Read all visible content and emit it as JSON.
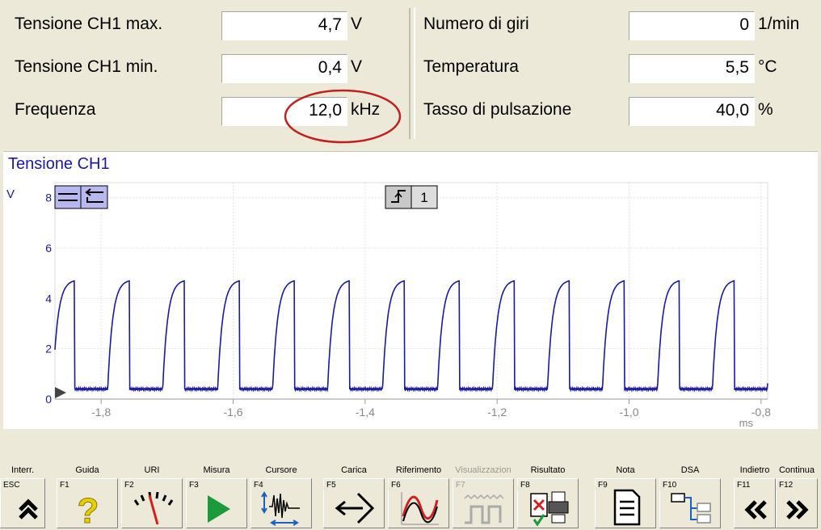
{
  "measurements_left": [
    {
      "label": "Tensione CH1 max.",
      "value": "4,7",
      "unit": "V"
    },
    {
      "label": "Tensione CH1 min.",
      "value": "0,4",
      "unit": "V"
    },
    {
      "label": "Frequenza",
      "value": "12,0",
      "unit": "kHz"
    }
  ],
  "measurements_right": [
    {
      "label": "Numero di giri",
      "value": "0",
      "unit": "1/min"
    },
    {
      "label": "Temperatura",
      "value": "5,5",
      "unit": "°C"
    },
    {
      "label": "Tasso di pulsazione",
      "value": "40,0",
      "unit": "%"
    }
  ],
  "highlight_color": "#c0201f",
  "chart": {
    "title": "Tensione CH1",
    "ylabel": "V",
    "xunit": "ms",
    "trigger_channel": "1",
    "y_ticks": [
      "8",
      "6",
      "4",
      "2",
      "0"
    ],
    "x_ticks": [
      "-1,8",
      "-1,6",
      "-1,4",
      "-1,2",
      "-1,0",
      "-0,8"
    ]
  },
  "chart_data": {
    "type": "line",
    "title": "Tensione CH1",
    "xlabel": "ms",
    "ylabel": "V",
    "xlim": [
      -1.87,
      -0.79
    ],
    "ylim": [
      0,
      8.6
    ],
    "grid": true,
    "series": [
      {
        "pulse_high": 4.7,
        "low": 0.4,
        "period_ms": 0.0833,
        "duty": 0.4,
        "first_rise_ms": -1.79
      }
    ]
  },
  "fkeys": [
    {
      "caption": "Interr.",
      "key": "ESC",
      "icon": "double-up-arrow-icon",
      "disabled": false
    },
    {
      "caption": "Guida",
      "key": "F1",
      "icon": "question-mark-icon",
      "disabled": false
    },
    {
      "caption": "URI",
      "key": "F2",
      "icon": "gauge-icon",
      "disabled": false
    },
    {
      "caption": "Misura",
      "key": "F3",
      "icon": "play-icon",
      "disabled": false
    },
    {
      "caption": "Cursore",
      "key": "F4",
      "icon": "cursor-waveform-icon",
      "disabled": false
    },
    {
      "caption": "Carica",
      "key": "F5",
      "icon": "load-arrow-icon",
      "disabled": false
    },
    {
      "caption": "Riferimento",
      "key": "F6",
      "icon": "reference-curve-icon",
      "disabled": false
    },
    {
      "caption": "Visualizzazion",
      "key": "F7",
      "icon": "square-wave-icon",
      "disabled": true
    },
    {
      "caption": "Risultato",
      "key": "F8",
      "icon": "result-print-icon",
      "disabled": false
    },
    {
      "caption": "Nota",
      "key": "F9",
      "icon": "note-document-icon",
      "disabled": false
    },
    {
      "caption": "DSA",
      "key": "F10",
      "icon": "dsa-tree-icon",
      "disabled": false
    },
    {
      "caption": "Indietro",
      "key": "F11",
      "icon": "double-left-arrow-icon",
      "disabled": false
    },
    {
      "caption": "Continua",
      "key": "F12",
      "icon": "double-right-arrow-icon",
      "disabled": false
    }
  ]
}
